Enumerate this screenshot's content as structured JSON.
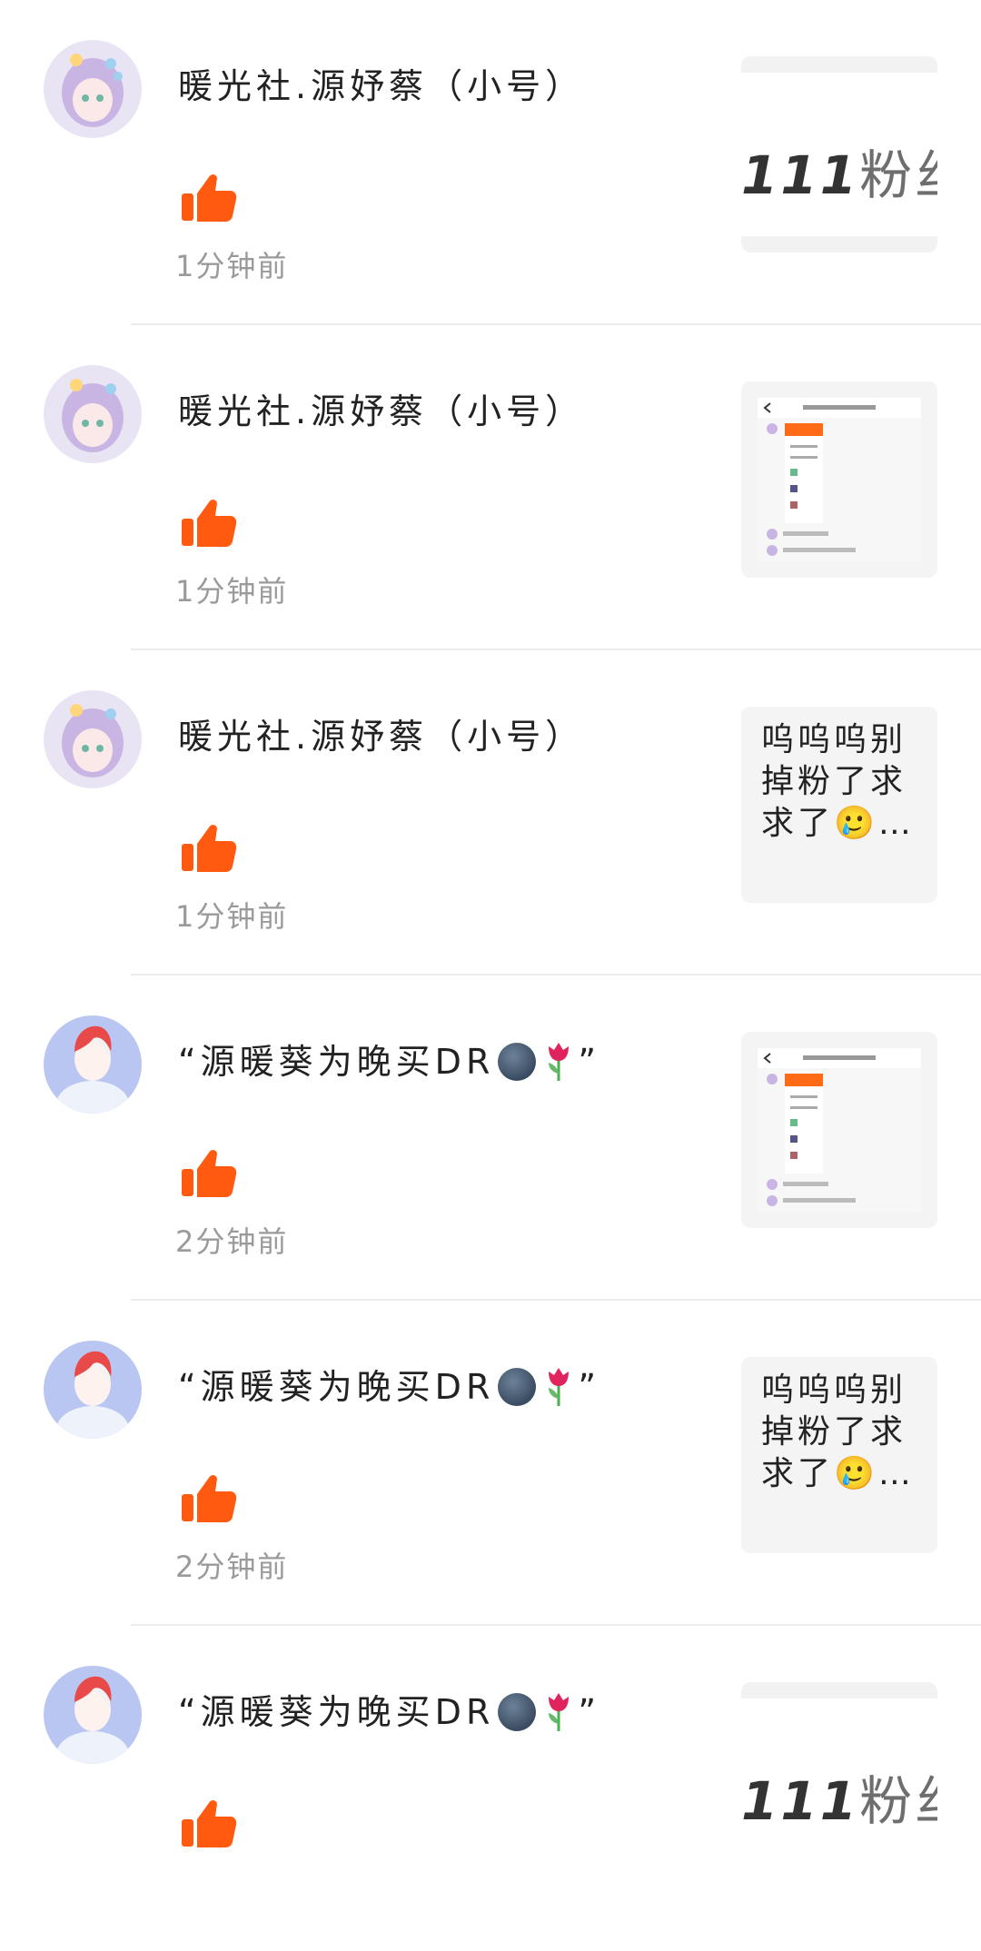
{
  "notifications": [
    {
      "user": "暖光社.源妤蔡（小号）",
      "time": "1分钟前",
      "avatar": "girl-avatar",
      "thumb": {
        "type": "fans",
        "number": "111",
        "label": "粉丝"
      }
    },
    {
      "user": "暖光社.源妤蔡（小号）",
      "time": "1分钟前",
      "avatar": "girl-avatar",
      "thumb": {
        "type": "screenshot"
      }
    },
    {
      "user": "暖光社.源妤蔡（小号）",
      "time": "1分钟前",
      "avatar": "girl-avatar",
      "thumb": {
        "type": "text",
        "text": "呜呜呜别掉粉了求求了🥲…"
      }
    },
    {
      "user_prefix": "“源暖葵为晚买DR",
      "user_suffix": "”",
      "time": "2分钟前",
      "avatar": "boy-avatar",
      "thumb": {
        "type": "screenshot"
      }
    },
    {
      "user_prefix": "“源暖葵为晚买DR",
      "user_suffix": "”",
      "time": "2分钟前",
      "avatar": "boy-avatar",
      "thumb": {
        "type": "text",
        "text": "呜呜呜别掉粉了求求了🥲…"
      }
    },
    {
      "user_prefix": "“源暖葵为晚买DR",
      "user_suffix": "”",
      "time": "",
      "avatar": "boy-avatar",
      "thumb": {
        "type": "fans",
        "number": "111",
        "label": "粉丝"
      }
    }
  ],
  "colors": {
    "like": "#ff5a0f",
    "divider": "#ececec",
    "time": "#9a9a9a",
    "thumb_bg": "#f4f4f4"
  }
}
